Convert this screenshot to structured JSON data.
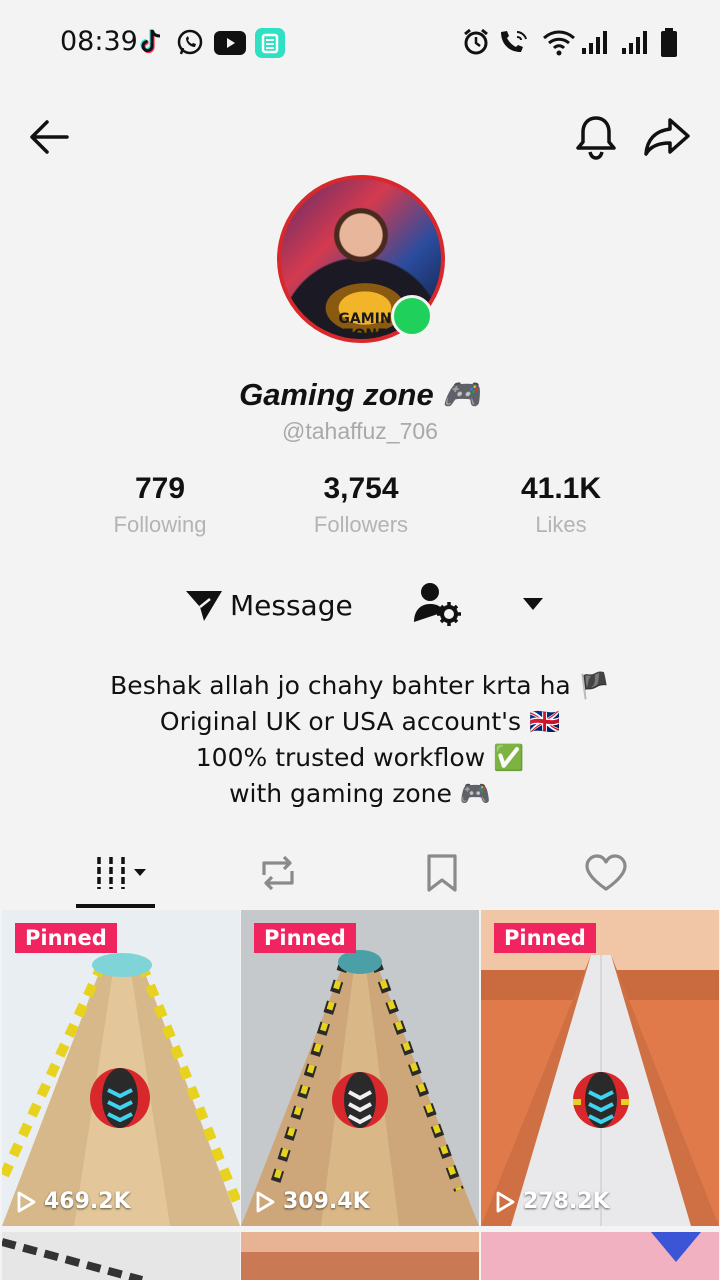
{
  "status_bar": {
    "time": "08:39",
    "notification_icons": [
      "tiktok-icon",
      "whatsapp-icon",
      "youtube-icon",
      "app-icon"
    ],
    "system_icons": [
      "alarm-icon",
      "wifi-call-icon",
      "wifi-icon",
      "signal-icon",
      "signal-icon",
      "battery-icon"
    ]
  },
  "header": {
    "back_icon": "back-arrow-icon",
    "bell_icon": "bell-icon",
    "share_icon": "share-icon"
  },
  "profile": {
    "avatar_text": "GAMIN ZONE",
    "display_name": "Gaming zone 🎮",
    "username": "@tahaffuz_706",
    "online": true
  },
  "stats": [
    {
      "value": "779",
      "label": "Following"
    },
    {
      "value": "3,754",
      "label": "Followers"
    },
    {
      "value": "41.1K",
      "label": "Likes"
    }
  ],
  "actions": {
    "message_label": "Message",
    "follow_settings_icon": "user-settings-icon",
    "more_icon": "dropdown-triangle-icon"
  },
  "bio": [
    "Beshak allah jo chahy bahter krta ha 🏴",
    "Original UK or USA account's 🇬🇧",
    "100% trusted workflow ✅",
    "with gaming zone 🎮"
  ],
  "tabs": [
    {
      "name": "videos",
      "icon": "grid-columns-icon"
    },
    {
      "name": "reposts",
      "icon": "repost-icon"
    },
    {
      "name": "saved",
      "icon": "bookmark-icon"
    },
    {
      "name": "liked",
      "icon": "heart-icon"
    }
  ],
  "videos": [
    {
      "pinned_label": "Pinned",
      "views": "469.2K"
    },
    {
      "pinned_label": "Pinned",
      "views": "309.4K"
    },
    {
      "pinned_label": "Pinned",
      "views": "278.2K"
    }
  ],
  "colors": {
    "pinned_badge": "#f0245f",
    "online_dot": "#1fd15a",
    "avatar_ring": "#d8282b",
    "muted_text": "#b4b4b4"
  }
}
